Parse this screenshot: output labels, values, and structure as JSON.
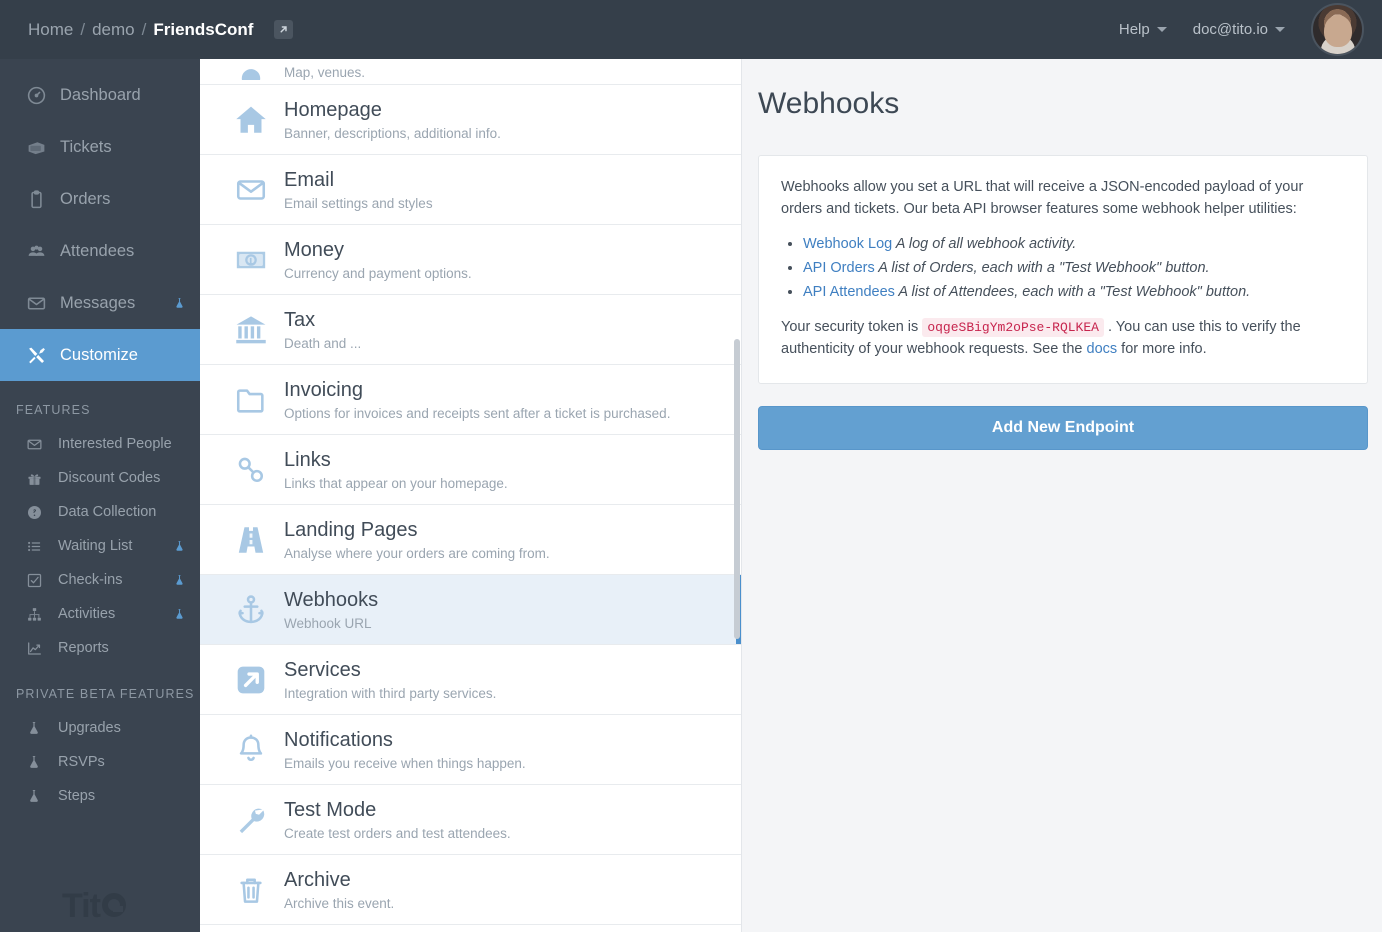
{
  "header": {
    "breadcrumb": {
      "home": "Home",
      "sep1": "/",
      "org": "demo",
      "sep2": "/",
      "event": "FriendsConf"
    },
    "external_link_icon": "external-link-icon",
    "help_label": "Help",
    "account_label": "doc@tito.io"
  },
  "sidebar": {
    "main_items": [
      {
        "label": "Dashboard",
        "icon": "gauge-icon",
        "active": false,
        "beta": false
      },
      {
        "label": "Tickets",
        "icon": "tickets-icon",
        "active": false,
        "beta": false
      },
      {
        "label": "Orders",
        "icon": "clipboard-icon",
        "active": false,
        "beta": false
      },
      {
        "label": "Attendees",
        "icon": "people-icon",
        "active": false,
        "beta": false
      },
      {
        "label": "Messages",
        "icon": "envelope-icon",
        "active": false,
        "beta": true
      },
      {
        "label": "Customize",
        "icon": "tools-icon",
        "active": true,
        "beta": false
      }
    ],
    "features_title": "FEATURES",
    "feature_items": [
      {
        "label": "Interested People",
        "icon": "envelope-icon",
        "beta": false
      },
      {
        "label": "Discount Codes",
        "icon": "gift-icon",
        "beta": false
      },
      {
        "label": "Data Collection",
        "icon": "question-circle-icon",
        "beta": false
      },
      {
        "label": "Waiting List",
        "icon": "list-icon",
        "beta": true
      },
      {
        "label": "Check-ins",
        "icon": "check-square-icon",
        "beta": true
      },
      {
        "label": "Activities",
        "icon": "sitemap-icon",
        "beta": true
      },
      {
        "label": "Reports",
        "icon": "chart-line-icon",
        "beta": false
      }
    ],
    "beta_title": "PRIVATE BETA FEATURES",
    "beta_items": [
      {
        "label": "Upgrades",
        "icon": "flask-icon"
      },
      {
        "label": "RSVPs",
        "icon": "flask-icon"
      },
      {
        "label": "Steps",
        "icon": "flask-icon"
      }
    ],
    "brand": "Tit"
  },
  "customize_list": [
    {
      "title": "",
      "desc": "Map, venues.",
      "icon": "map-pin-icon",
      "selected": false,
      "partial": true
    },
    {
      "title": "Homepage",
      "desc": "Banner, descriptions, additional info.",
      "icon": "home-icon",
      "selected": false,
      "partial": false
    },
    {
      "title": "Email",
      "desc": "Email settings and styles",
      "icon": "envelope-icon",
      "selected": false,
      "partial": false
    },
    {
      "title": "Money",
      "desc": "Currency and payment options.",
      "icon": "banknote-icon",
      "selected": false,
      "partial": false
    },
    {
      "title": "Tax",
      "desc": "Death and ...",
      "icon": "bank-icon",
      "selected": false,
      "partial": false
    },
    {
      "title": "Invoicing",
      "desc": "Options for invoices and receipts sent after a ticket is purchased.",
      "icon": "folder-icon",
      "selected": false,
      "partial": false
    },
    {
      "title": "Links",
      "desc": "Links that appear on your homepage.",
      "icon": "chain-icon",
      "selected": false,
      "partial": false
    },
    {
      "title": "Landing Pages",
      "desc": "Analyse where your orders are coming from.",
      "icon": "road-icon",
      "selected": false,
      "partial": false
    },
    {
      "title": "Webhooks",
      "desc": "Webhook URL",
      "icon": "anchor-icon",
      "selected": true,
      "partial": false
    },
    {
      "title": "Services",
      "desc": "Integration with third party services.",
      "icon": "external-link-square-icon",
      "selected": false,
      "partial": false
    },
    {
      "title": "Notifications",
      "desc": "Emails you receive when things happen.",
      "icon": "bell-icon",
      "selected": false,
      "partial": false
    },
    {
      "title": "Test Mode",
      "desc": "Create test orders and test attendees.",
      "icon": "wrench-icon",
      "selected": false,
      "partial": false
    },
    {
      "title": "Archive",
      "desc": "Archive this event.",
      "icon": "trash-icon",
      "selected": false,
      "partial": false
    }
  ],
  "main": {
    "title": "Webhooks",
    "intro": "Webhooks allow you set a URL that will receive a JSON-encoded payload of your orders and tickets. Our beta API browser features some webhook helper utilities:",
    "bullets": [
      {
        "link": "Webhook Log",
        "text": "A log of all webhook activity."
      },
      {
        "link": "API Orders",
        "text": "A list of Orders, each with a \"Test Webhook\" button."
      },
      {
        "link": "API Attendees",
        "text": "A list of Attendees, each with a \"Test Webhook\" button."
      }
    ],
    "token_prefix": "Your security token is",
    "token": "oqgeSBigYm2oPse-RQLKEA",
    "token_mid": ". You can use this to verify the authenticity of your webhook requests. See the",
    "docs_link": "docs",
    "token_suffix": "for more info.",
    "add_endpoint_label": "Add New Endpoint"
  },
  "colors": {
    "topbar": "#353f4a",
    "sidebar": "#3a4450",
    "accent": "#5b9bd0",
    "selected_row": "#e8f0f8",
    "icon_blue": "#a8c8e4",
    "link": "#3f7fc1",
    "token_text": "#c7254e",
    "token_bg": "#fbeaee",
    "button": "#63a0d1"
  }
}
